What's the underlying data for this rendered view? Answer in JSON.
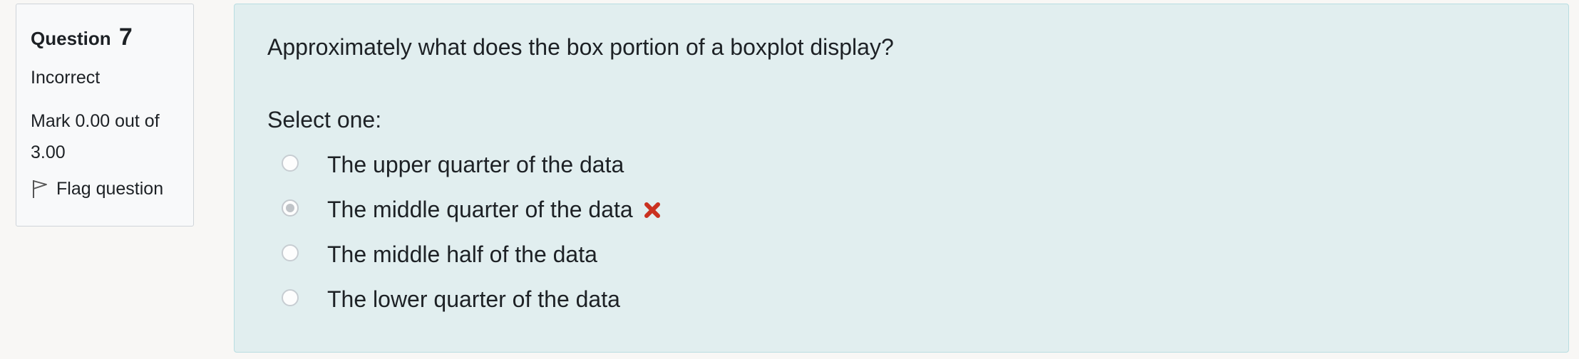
{
  "info": {
    "question_label": "Question",
    "question_number": "7",
    "state": "Incorrect",
    "grade": "Mark 0.00 out of 3.00",
    "flag_label": "Flag question",
    "flag_icon": "flag-icon"
  },
  "question": {
    "text": "Approximately what does the box portion of a boxplot display?",
    "prompt": "Select one:",
    "answers": [
      {
        "label": "The upper quarter of the data",
        "selected": false
      },
      {
        "label": "The middle quarter of the data",
        "selected": true,
        "feedback_icon": "incorrect-cross-icon"
      },
      {
        "label": "The middle half of the data",
        "selected": false
      },
      {
        "label": "The lower quarter of the data",
        "selected": false
      }
    ]
  },
  "colors": {
    "content_bg": "#e1eeef",
    "content_border": "#b8dde1",
    "info_bg": "#f8f9fa",
    "incorrect": "#ca3120"
  }
}
